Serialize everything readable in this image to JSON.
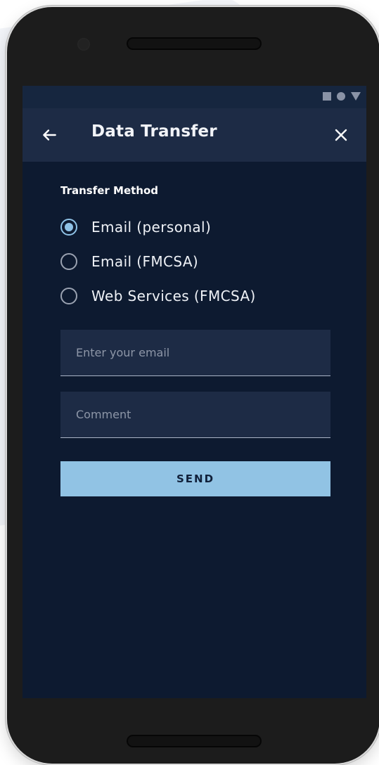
{
  "colors": {
    "screen_bg": "#0d1a30",
    "app_bar_bg": "#1d2b45",
    "accent": "#91c3e4",
    "field_bg": "#1d2b45"
  },
  "status_bar": {
    "icons": [
      "stop-square-icon",
      "circle-icon",
      "triangle-down-icon"
    ]
  },
  "app_bar": {
    "back_icon": "arrow-left-icon",
    "title": "Data Transfer",
    "close_icon": "close-x-icon"
  },
  "form": {
    "section_label": "Transfer Method",
    "options": [
      {
        "label": "Email (personal)",
        "checked": true
      },
      {
        "label": "Email (FMCSA)",
        "checked": false
      },
      {
        "label": "Web Services (FMCSA)",
        "checked": false
      }
    ],
    "email_field": {
      "placeholder": "Enter your email",
      "value": ""
    },
    "comment_field": {
      "placeholder": "Comment",
      "value": ""
    },
    "send_label": "SEND"
  }
}
